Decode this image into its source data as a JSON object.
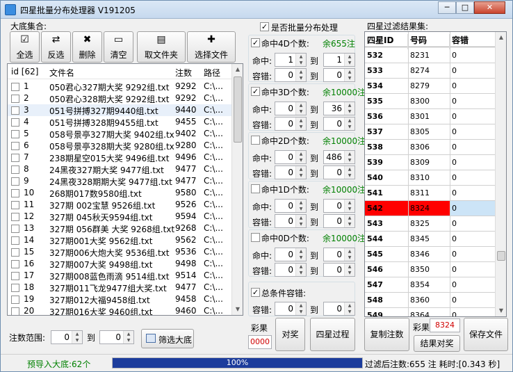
{
  "window": {
    "title": "四星批量分布处理器 V191205",
    "min": "─",
    "max": "□",
    "close": "✕"
  },
  "left": {
    "group_label": "大底集合:",
    "toolbar": [
      {
        "label": "全选",
        "icon": "select-all-icon"
      },
      {
        "label": "反选",
        "icon": "invert-select-icon"
      },
      {
        "label": "删除",
        "icon": "delete-icon"
      },
      {
        "label": "清空",
        "icon": "clear-icon"
      },
      {
        "label": "取文件夹",
        "icon": "folder-icon"
      },
      {
        "label": "选择文件",
        "icon": "file-add-icon"
      }
    ],
    "columns": [
      "id [62]",
      "文件名",
      "注数",
      "路径"
    ],
    "rows": [
      {
        "id": "1",
        "name": "050君心327期大奖 9292组.txt",
        "count": "9292",
        "path": "C:\\..."
      },
      {
        "id": "2",
        "name": "050君心328期大奖 9292组.txt",
        "count": "9292",
        "path": "C:\\..."
      },
      {
        "id": "3",
        "name": "051号拼搏327期9440组.txt",
        "count": "9440",
        "path": "C:\\..."
      },
      {
        "id": "4",
        "name": "051号拼搏328期9455组.txt",
        "count": "9455",
        "path": "C:\\..."
      },
      {
        "id": "5",
        "name": "058号景亭327期大奖 9402组.txt",
        "count": "9402",
        "path": "C:\\..."
      },
      {
        "id": "6",
        "name": "058号景亭328期大奖 9280组.txt",
        "count": "9280",
        "path": "C:\\..."
      },
      {
        "id": "7",
        "name": "238期星空015大奖 9496组.txt",
        "count": "9496",
        "path": "C:\\..."
      },
      {
        "id": "8",
        "name": "24黑夜327期大奖 9477组.txt",
        "count": "9477",
        "path": "C:\\..."
      },
      {
        "id": "9",
        "name": "24黑夜328期期大奖 9477组.txt",
        "count": "9477",
        "path": "C:\\..."
      },
      {
        "id": "10",
        "name": "268期017数9580组.txt",
        "count": "9580",
        "path": "C:\\..."
      },
      {
        "id": "11",
        "name": "327期 002宝慧 9526组.txt",
        "count": "9526",
        "path": "C:\\..."
      },
      {
        "id": "12",
        "name": "327期 045秋天9594组.txt",
        "count": "9594",
        "path": "C:\\..."
      },
      {
        "id": "13",
        "name": "327期 056群美 大奖 9268组.txt",
        "count": "9268",
        "path": "C:\\..."
      },
      {
        "id": "14",
        "name": "327期001大奖 9562组.txt",
        "count": "9562",
        "path": "C:\\..."
      },
      {
        "id": "15",
        "name": "327期006大炮大奖 9536组.txt",
        "count": "9536",
        "path": "C:\\..."
      },
      {
        "id": "16",
        "name": "327期007大奖 9498组.txt",
        "count": "9498",
        "path": "C:\\..."
      },
      {
        "id": "17",
        "name": "327期008蓝色雨滴 9514组.txt",
        "count": "9514",
        "path": "C:\\..."
      },
      {
        "id": "18",
        "name": "327期011飞龙9477组大奖.txt",
        "count": "9477",
        "path": "C:\\..."
      },
      {
        "id": "19",
        "name": "327期012大福9458组.txt",
        "count": "9458",
        "path": "C:\\..."
      },
      {
        "id": "20",
        "name": "327期016大奖 9460组.txt",
        "count": "9460",
        "path": "C:\\..."
      }
    ],
    "range_label": "注数范围:",
    "range_from": "0",
    "range_to_label": "到",
    "range_to": "0",
    "filter_button": "筛选大底"
  },
  "middle": {
    "batch_label": "是否批量分布处理",
    "sections": [
      {
        "title": "命中4D个数:",
        "checked": true,
        "summary": "余655注",
        "rows": [
          {
            "label": "命中:",
            "a": "1",
            "b": "1"
          },
          {
            "label": "容错:",
            "a": "0",
            "b": "0"
          }
        ]
      },
      {
        "title": "命中3D个数:",
        "checked": true,
        "summary": "余10000注",
        "rows": [
          {
            "label": "命中:",
            "a": "0",
            "b": "36"
          },
          {
            "label": "容错:",
            "a": "0",
            "b": "0"
          }
        ]
      },
      {
        "title": "命中2D个数:",
        "checked": false,
        "summary": "余10000注",
        "rows": [
          {
            "label": "命中:",
            "a": "0",
            "b": "486"
          },
          {
            "label": "容错:",
            "a": "0",
            "b": "0"
          }
        ]
      },
      {
        "title": "命中1D个数:",
        "checked": false,
        "summary": "余10000注",
        "rows": [
          {
            "label": "命中:",
            "a": "0",
            "b": "0"
          },
          {
            "label": "容错:",
            "a": "0",
            "b": "0"
          }
        ]
      },
      {
        "title": "命中0D个数:",
        "checked": false,
        "summary": "余10000注",
        "rows": [
          {
            "label": "命中:",
            "a": "0",
            "b": "0"
          },
          {
            "label": "容错:",
            "a": "0",
            "b": "0"
          }
        ]
      }
    ],
    "to_label": "到",
    "total_label": "总条件容错:",
    "total_row": {
      "label": "容错:",
      "a": "0",
      "b": "0"
    },
    "lottery_label": "彩果",
    "lottery_value": "0000",
    "match_button": "对奖",
    "process_button": "四星过程"
  },
  "right": {
    "group_label": "四星过滤结果集:",
    "columns": [
      "四星ID",
      "号码",
      "容错"
    ],
    "rows": [
      {
        "id": "532",
        "num": "8231",
        "tol": "0"
      },
      {
        "id": "533",
        "num": "8274",
        "tol": "0"
      },
      {
        "id": "534",
        "num": "8279",
        "tol": "0"
      },
      {
        "id": "535",
        "num": "8300",
        "tol": "0"
      },
      {
        "id": "536",
        "num": "8301",
        "tol": "0"
      },
      {
        "id": "537",
        "num": "8305",
        "tol": "0"
      },
      {
        "id": "538",
        "num": "8306",
        "tol": "0"
      },
      {
        "id": "539",
        "num": "8309",
        "tol": "0"
      },
      {
        "id": "540",
        "num": "8310",
        "tol": "0"
      },
      {
        "id": "541",
        "num": "8311",
        "tol": "0"
      },
      {
        "id": "542",
        "num": "8324",
        "tol": "0",
        "highlight": true
      },
      {
        "id": "543",
        "num": "8325",
        "tol": "0"
      },
      {
        "id": "544",
        "num": "8345",
        "tol": "0"
      },
      {
        "id": "545",
        "num": "8346",
        "tol": "0"
      },
      {
        "id": "546",
        "num": "8350",
        "tol": "0"
      },
      {
        "id": "547",
        "num": "8354",
        "tol": "0"
      },
      {
        "id": "548",
        "num": "8360",
        "tol": "0"
      },
      {
        "id": "549",
        "num": "8364",
        "tol": "0"
      }
    ],
    "copy_button": "复制注数",
    "lottery_label": "彩果",
    "lottery_value": "8324",
    "result_button": "结果对奖",
    "save_button": "保存文件"
  },
  "status": {
    "left": "预导入大底:62个",
    "progress_label": "100%",
    "progress": 1.0,
    "right": "过滤后注数:655 注 耗时:[0.343 秒]"
  },
  "colors": {
    "highlight_row": "#ff0000",
    "selection": "#cce4f7",
    "green": "#008000",
    "lottery_red": "#d00000"
  }
}
